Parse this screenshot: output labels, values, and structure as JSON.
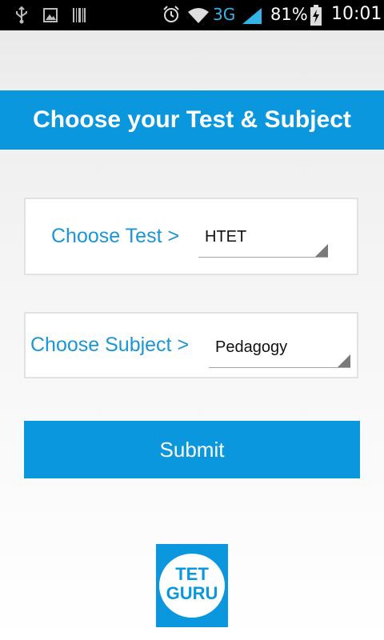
{
  "status_bar": {
    "network": "3G",
    "battery_percent": "81%",
    "time": "10:01",
    "icons": [
      "usb-icon",
      "image-icon",
      "barcode-icon",
      "alarm-icon",
      "wifi-icon",
      "signal-icon",
      "battery-charging-icon"
    ]
  },
  "header": {
    "title": "Choose your Test & Subject"
  },
  "test_selector": {
    "label": "Choose Test >",
    "value": "HTET"
  },
  "subject_selector": {
    "label": "Choose Subject >",
    "value": "Pedagogy"
  },
  "submit": {
    "label": "Submit"
  },
  "logo": {
    "line1": "TET",
    "line2": "GURU"
  },
  "colors": {
    "accent": "#0b97dd",
    "label_text": "#1a96d6",
    "status_bar": "#000000",
    "network_indicator": "#33b5e5"
  }
}
